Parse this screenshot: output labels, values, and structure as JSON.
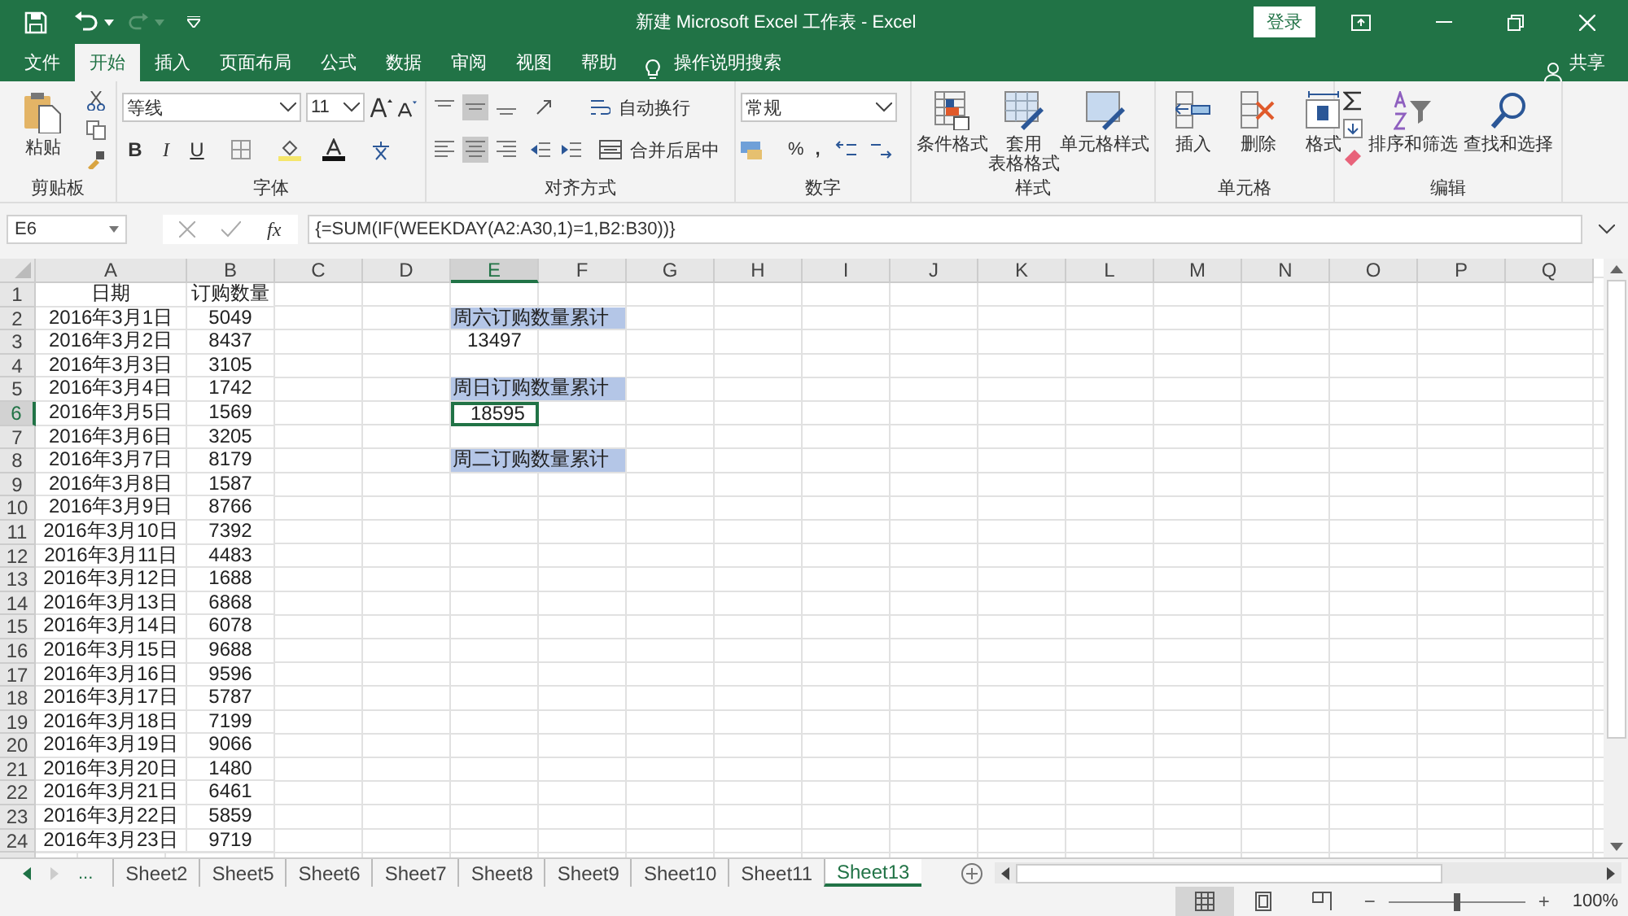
{
  "window": {
    "title": "新建 Microsoft Excel 工作表  -  Excel",
    "sign_in": "登录"
  },
  "tabs": [
    {
      "label": "文件",
      "selected": false
    },
    {
      "label": "开始",
      "selected": true
    },
    {
      "label": "插入",
      "selected": false
    },
    {
      "label": "页面布局",
      "selected": false
    },
    {
      "label": "公式",
      "selected": false
    },
    {
      "label": "数据",
      "selected": false
    },
    {
      "label": "审阅",
      "selected": false
    },
    {
      "label": "视图",
      "selected": false
    },
    {
      "label": "帮助",
      "selected": false
    }
  ],
  "tell_me": "操作说明搜索",
  "share": "共享",
  "ribbon": {
    "clipboard": {
      "label": "剪贴板",
      "paste": "粘贴"
    },
    "font": {
      "label": "字体",
      "name": "等线",
      "size": "11",
      "bold": "B",
      "italic": "I",
      "underline": "U"
    },
    "alignment": {
      "label": "对齐方式",
      "wrap": "自动换行",
      "merge": "合并后居中",
      "valign": [
        {
          "selected": false
        },
        {
          "selected": true
        },
        {
          "selected": false
        }
      ],
      "halign": [
        {
          "selected": false
        },
        {
          "selected": true
        },
        {
          "selected": false
        }
      ]
    },
    "number": {
      "label": "数字",
      "format": "常规",
      "percent": "%",
      "comma": ","
    },
    "styles": {
      "label": "样式",
      "conditional": "条件格式",
      "table_1": "套用",
      "table_2": "表格格式",
      "cell": "单元格样式"
    },
    "cells": {
      "label": "单元格",
      "insert": "插入",
      "delete": "删除",
      "format": "格式"
    },
    "editing": {
      "label": "编辑",
      "sort": "排序和筛选",
      "find": "查找和选择"
    }
  },
  "formula_bar": {
    "name_box": "E6",
    "fx": "fx",
    "formula": "{=SUM(IF(WEEKDAY(A2:A30,1)=1,B2:B30))}"
  },
  "columns": [
    {
      "label": "A",
      "selected": false
    },
    {
      "label": "B",
      "selected": false
    },
    {
      "label": "C",
      "selected": false
    },
    {
      "label": "D",
      "selected": false
    },
    {
      "label": "E",
      "selected": true
    },
    {
      "label": "F",
      "selected": false
    },
    {
      "label": "G",
      "selected": false
    },
    {
      "label": "H",
      "selected": false
    },
    {
      "label": "I",
      "selected": false
    },
    {
      "label": "J",
      "selected": false
    },
    {
      "label": "K",
      "selected": false
    },
    {
      "label": "L",
      "selected": false
    },
    {
      "label": "M",
      "selected": false
    },
    {
      "label": "N",
      "selected": false
    },
    {
      "label": "O",
      "selected": false
    },
    {
      "label": "P",
      "selected": false
    },
    {
      "label": "Q",
      "selected": false
    }
  ],
  "rows": [
    {
      "header": "1",
      "selected": false,
      "a": "日期",
      "b": "订购数量"
    },
    {
      "header": "2",
      "selected": false,
      "a": "2016年3月1日",
      "b": "5049",
      "e": {
        "text": "周六订购数量累计",
        "kind": "label",
        "selected": false
      }
    },
    {
      "header": "3",
      "selected": false,
      "a": "2016年3月2日",
      "b": "8437",
      "e": {
        "text": "13497",
        "kind": "value",
        "selected": false
      }
    },
    {
      "header": "4",
      "selected": false,
      "a": "2016年3月3日",
      "b": "3105"
    },
    {
      "header": "5",
      "selected": false,
      "a": "2016年3月4日",
      "b": "1742",
      "e": {
        "text": "周日订购数量累计",
        "kind": "label",
        "selected": false
      }
    },
    {
      "header": "6",
      "selected": true,
      "a": "2016年3月5日",
      "b": "1569",
      "e": {
        "text": "18595",
        "kind": "value",
        "selected": true
      }
    },
    {
      "header": "7",
      "selected": false,
      "a": "2016年3月6日",
      "b": "3205"
    },
    {
      "header": "8",
      "selected": false,
      "a": "2016年3月7日",
      "b": "8179",
      "e": {
        "text": "周二订购数量累计",
        "kind": "label",
        "selected": false
      }
    },
    {
      "header": "9",
      "selected": false,
      "a": "2016年3月8日",
      "b": "1587"
    },
    {
      "header": "10",
      "selected": false,
      "a": "2016年3月9日",
      "b": "8766"
    },
    {
      "header": "11",
      "selected": false,
      "a": "2016年3月10日",
      "b": "7392"
    },
    {
      "header": "12",
      "selected": false,
      "a": "2016年3月11日",
      "b": "4483"
    },
    {
      "header": "13",
      "selected": false,
      "a": "2016年3月12日",
      "b": "1688"
    },
    {
      "header": "14",
      "selected": false,
      "a": "2016年3月13日",
      "b": "6868"
    },
    {
      "header": "15",
      "selected": false,
      "a": "2016年3月14日",
      "b": "6078"
    },
    {
      "header": "16",
      "selected": false,
      "a": "2016年3月15日",
      "b": "9688"
    },
    {
      "header": "17",
      "selected": false,
      "a": "2016年3月16日",
      "b": "9596"
    },
    {
      "header": "18",
      "selected": false,
      "a": "2016年3月17日",
      "b": "5787"
    },
    {
      "header": "19",
      "selected": false,
      "a": "2016年3月18日",
      "b": "7199"
    },
    {
      "header": "20",
      "selected": false,
      "a": "2016年3月19日",
      "b": "9066"
    },
    {
      "header": "21",
      "selected": false,
      "a": "2016年3月20日",
      "b": "1480"
    },
    {
      "header": "22",
      "selected": false,
      "a": "2016年3月21日",
      "b": "6461"
    },
    {
      "header": "23",
      "selected": false,
      "a": "2016年3月22日",
      "b": "5859"
    },
    {
      "header": "24",
      "selected": false,
      "a": "2016年3月23日",
      "b": "9719"
    }
  ],
  "sheet_nav": {
    "more": "..."
  },
  "sheets": [
    {
      "label": "Sheet2",
      "selected": false
    },
    {
      "label": "Sheet5",
      "selected": false
    },
    {
      "label": "Sheet6",
      "selected": false
    },
    {
      "label": "Sheet7",
      "selected": false
    },
    {
      "label": "Sheet8",
      "selected": false
    },
    {
      "label": "Sheet9",
      "selected": false
    },
    {
      "label": "Sheet10",
      "selected": false
    },
    {
      "label": "Sheet11",
      "selected": false
    },
    {
      "label": "Sheet13",
      "selected": true
    }
  ],
  "status_bar": {
    "zoom_out": "−",
    "zoom_in": "+",
    "zoom": "100%",
    "level": 0.5,
    "views": [
      {
        "selected": true
      },
      {
        "selected": false
      },
      {
        "selected": false
      }
    ]
  }
}
